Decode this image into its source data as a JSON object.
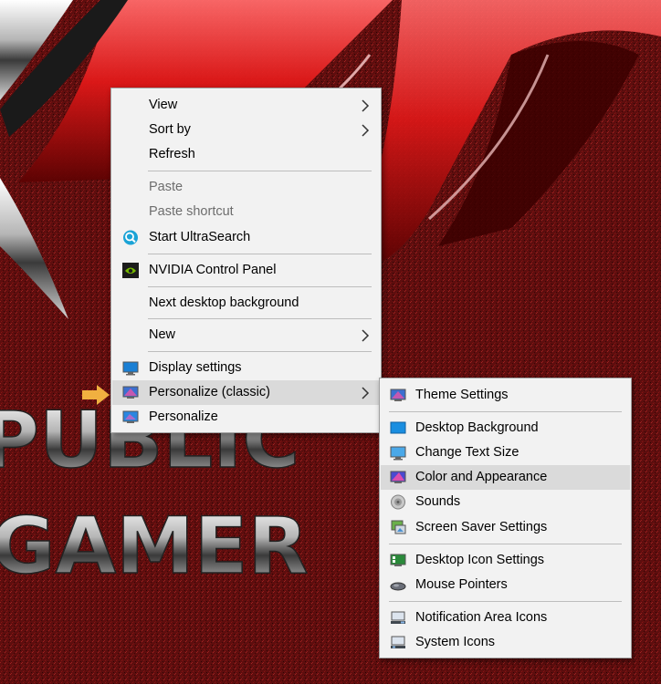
{
  "context_menu": {
    "items": [
      {
        "label": "View",
        "has_submenu": true
      },
      {
        "label": "Sort by",
        "has_submenu": true
      },
      {
        "label": "Refresh"
      },
      {
        "label": "Paste",
        "disabled": true
      },
      {
        "label": "Paste shortcut",
        "disabled": true
      },
      {
        "label": "Start UltraSearch",
        "icon": "ultrasearch-icon"
      },
      {
        "label": "NVIDIA Control Panel",
        "icon": "nvidia-icon"
      },
      {
        "label": "Next desktop background"
      },
      {
        "label": "New",
        "has_submenu": true
      },
      {
        "label": "Display settings",
        "icon": "display-icon"
      },
      {
        "label": "Personalize (classic)",
        "icon": "personalize-classic-icon",
        "has_submenu": true,
        "highlighted": true
      },
      {
        "label": "Personalize",
        "icon": "personalize-icon"
      }
    ]
  },
  "submenu": {
    "items": [
      {
        "label": "Theme Settings",
        "icon": "theme-icon"
      },
      {
        "label": "Desktop Background",
        "icon": "desktop-background-icon"
      },
      {
        "label": "Change Text Size",
        "icon": "monitor-icon"
      },
      {
        "label": "Color and Appearance",
        "icon": "color-icon",
        "highlighted": true
      },
      {
        "label": "Sounds",
        "icon": "speaker-icon"
      },
      {
        "label": "Screen Saver Settings",
        "icon": "screensaver-icon"
      },
      {
        "label": "Desktop Icon Settings",
        "icon": "desktop-icons-icon"
      },
      {
        "label": "Mouse Pointers",
        "icon": "mouse-icon"
      },
      {
        "label": "Notification Area Icons",
        "icon": "notification-icon"
      },
      {
        "label": "System Icons",
        "icon": "system-icons-icon"
      }
    ]
  },
  "wallpaper": {
    "text_line_1": "PUBLIC",
    "text_line_2": "GAMER",
    "colors": {
      "background": "#5a0d0d",
      "accent": "#e01818"
    }
  },
  "colors": {
    "menu_bg": "#f2f2f2",
    "highlight": "#dadada",
    "pointer_arrow": "#f0b040"
  }
}
